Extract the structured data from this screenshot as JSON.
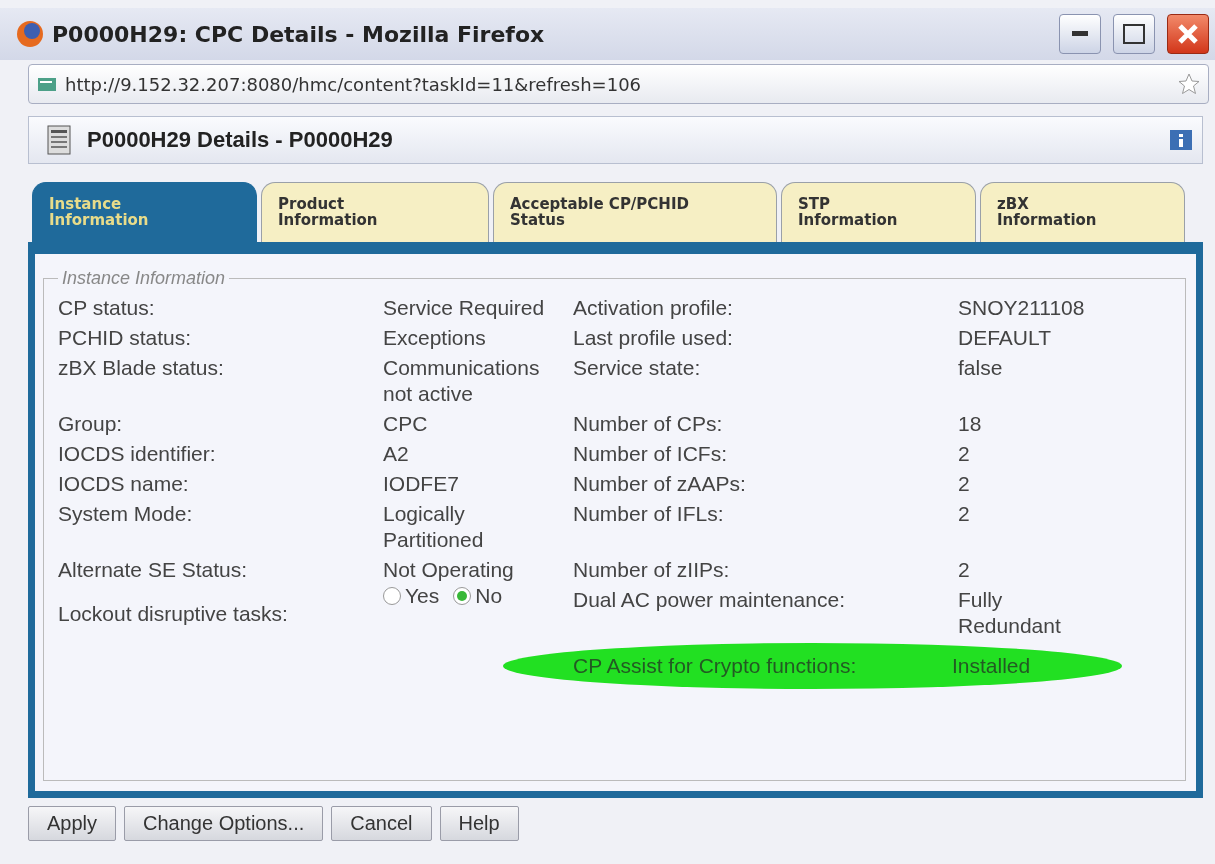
{
  "window": {
    "title": "P0000H29: CPC Details - Mozilla Firefox"
  },
  "address_bar": {
    "url": "http://9.152.32.207:8080/hmc/content?taskId=11&refresh=106"
  },
  "panel": {
    "title": "P0000H29 Details - P0000H29"
  },
  "tabs": [
    {
      "label": "Instance Information",
      "selected": true
    },
    {
      "label": "Product Information",
      "selected": false
    },
    {
      "label": "Acceptable CP/PCHID Status",
      "selected": false
    },
    {
      "label": "STP Information",
      "selected": false
    },
    {
      "label": "zBX Information",
      "selected": false
    }
  ],
  "group": {
    "legend": "Instance Information"
  },
  "rows": [
    {
      "left": {
        "kind": "text",
        "label": "CP status:",
        "value": "Service Required"
      },
      "right": {
        "label": "Activation profile:",
        "value": "SNOY211108"
      }
    },
    {
      "left": {
        "kind": "text",
        "label": "PCHID status:",
        "value": "Exceptions"
      },
      "right": {
        "label": "Last profile used:",
        "value": "DEFAULT"
      }
    },
    {
      "left": {
        "kind": "text",
        "label": "zBX Blade status:",
        "value": "Communications not active"
      },
      "right": {
        "label": "Service state:",
        "value": "false"
      }
    },
    {
      "left": {
        "kind": "text",
        "label": "Group:",
        "value": "CPC"
      },
      "right": {
        "label": "Number of CPs:",
        "value": "18"
      }
    },
    {
      "left": {
        "kind": "text",
        "label": "IOCDS identifier:",
        "value": "A2"
      },
      "right": {
        "label": "Number of ICFs:",
        "value": "2"
      }
    },
    {
      "left": {
        "kind": "text",
        "label": "IOCDS name:",
        "value": "IODFE7"
      },
      "right": {
        "label": "Number of zAAPs:",
        "value": "2"
      }
    },
    {
      "left": {
        "kind": "text",
        "label": "System Mode:",
        "value": "Logically Partitioned"
      },
      "right": {
        "label": "Number of IFLs:",
        "value": "2"
      }
    },
    {
      "left": {
        "kind": "text",
        "label": "Alternate SE Status:",
        "value": "Not Operating"
      },
      "right": {
        "label": "Number of zIIPs:",
        "value": "2"
      }
    },
    {
      "left": {
        "kind": "radio",
        "label": "Lockout disruptive tasks:",
        "options": [
          {
            "label": "Yes",
            "selected": false
          },
          {
            "label": "No",
            "selected": true
          }
        ]
      },
      "right": {
        "label": "Dual AC power maintenance:",
        "value": "Fully Redundant"
      }
    },
    {
      "right": {
        "label": "CP Assist for Crypto functions:",
        "value": "Installed",
        "highlighted": true
      }
    }
  ],
  "buttons": [
    "Apply",
    "Change Options...",
    "Cancel",
    "Help"
  ]
}
